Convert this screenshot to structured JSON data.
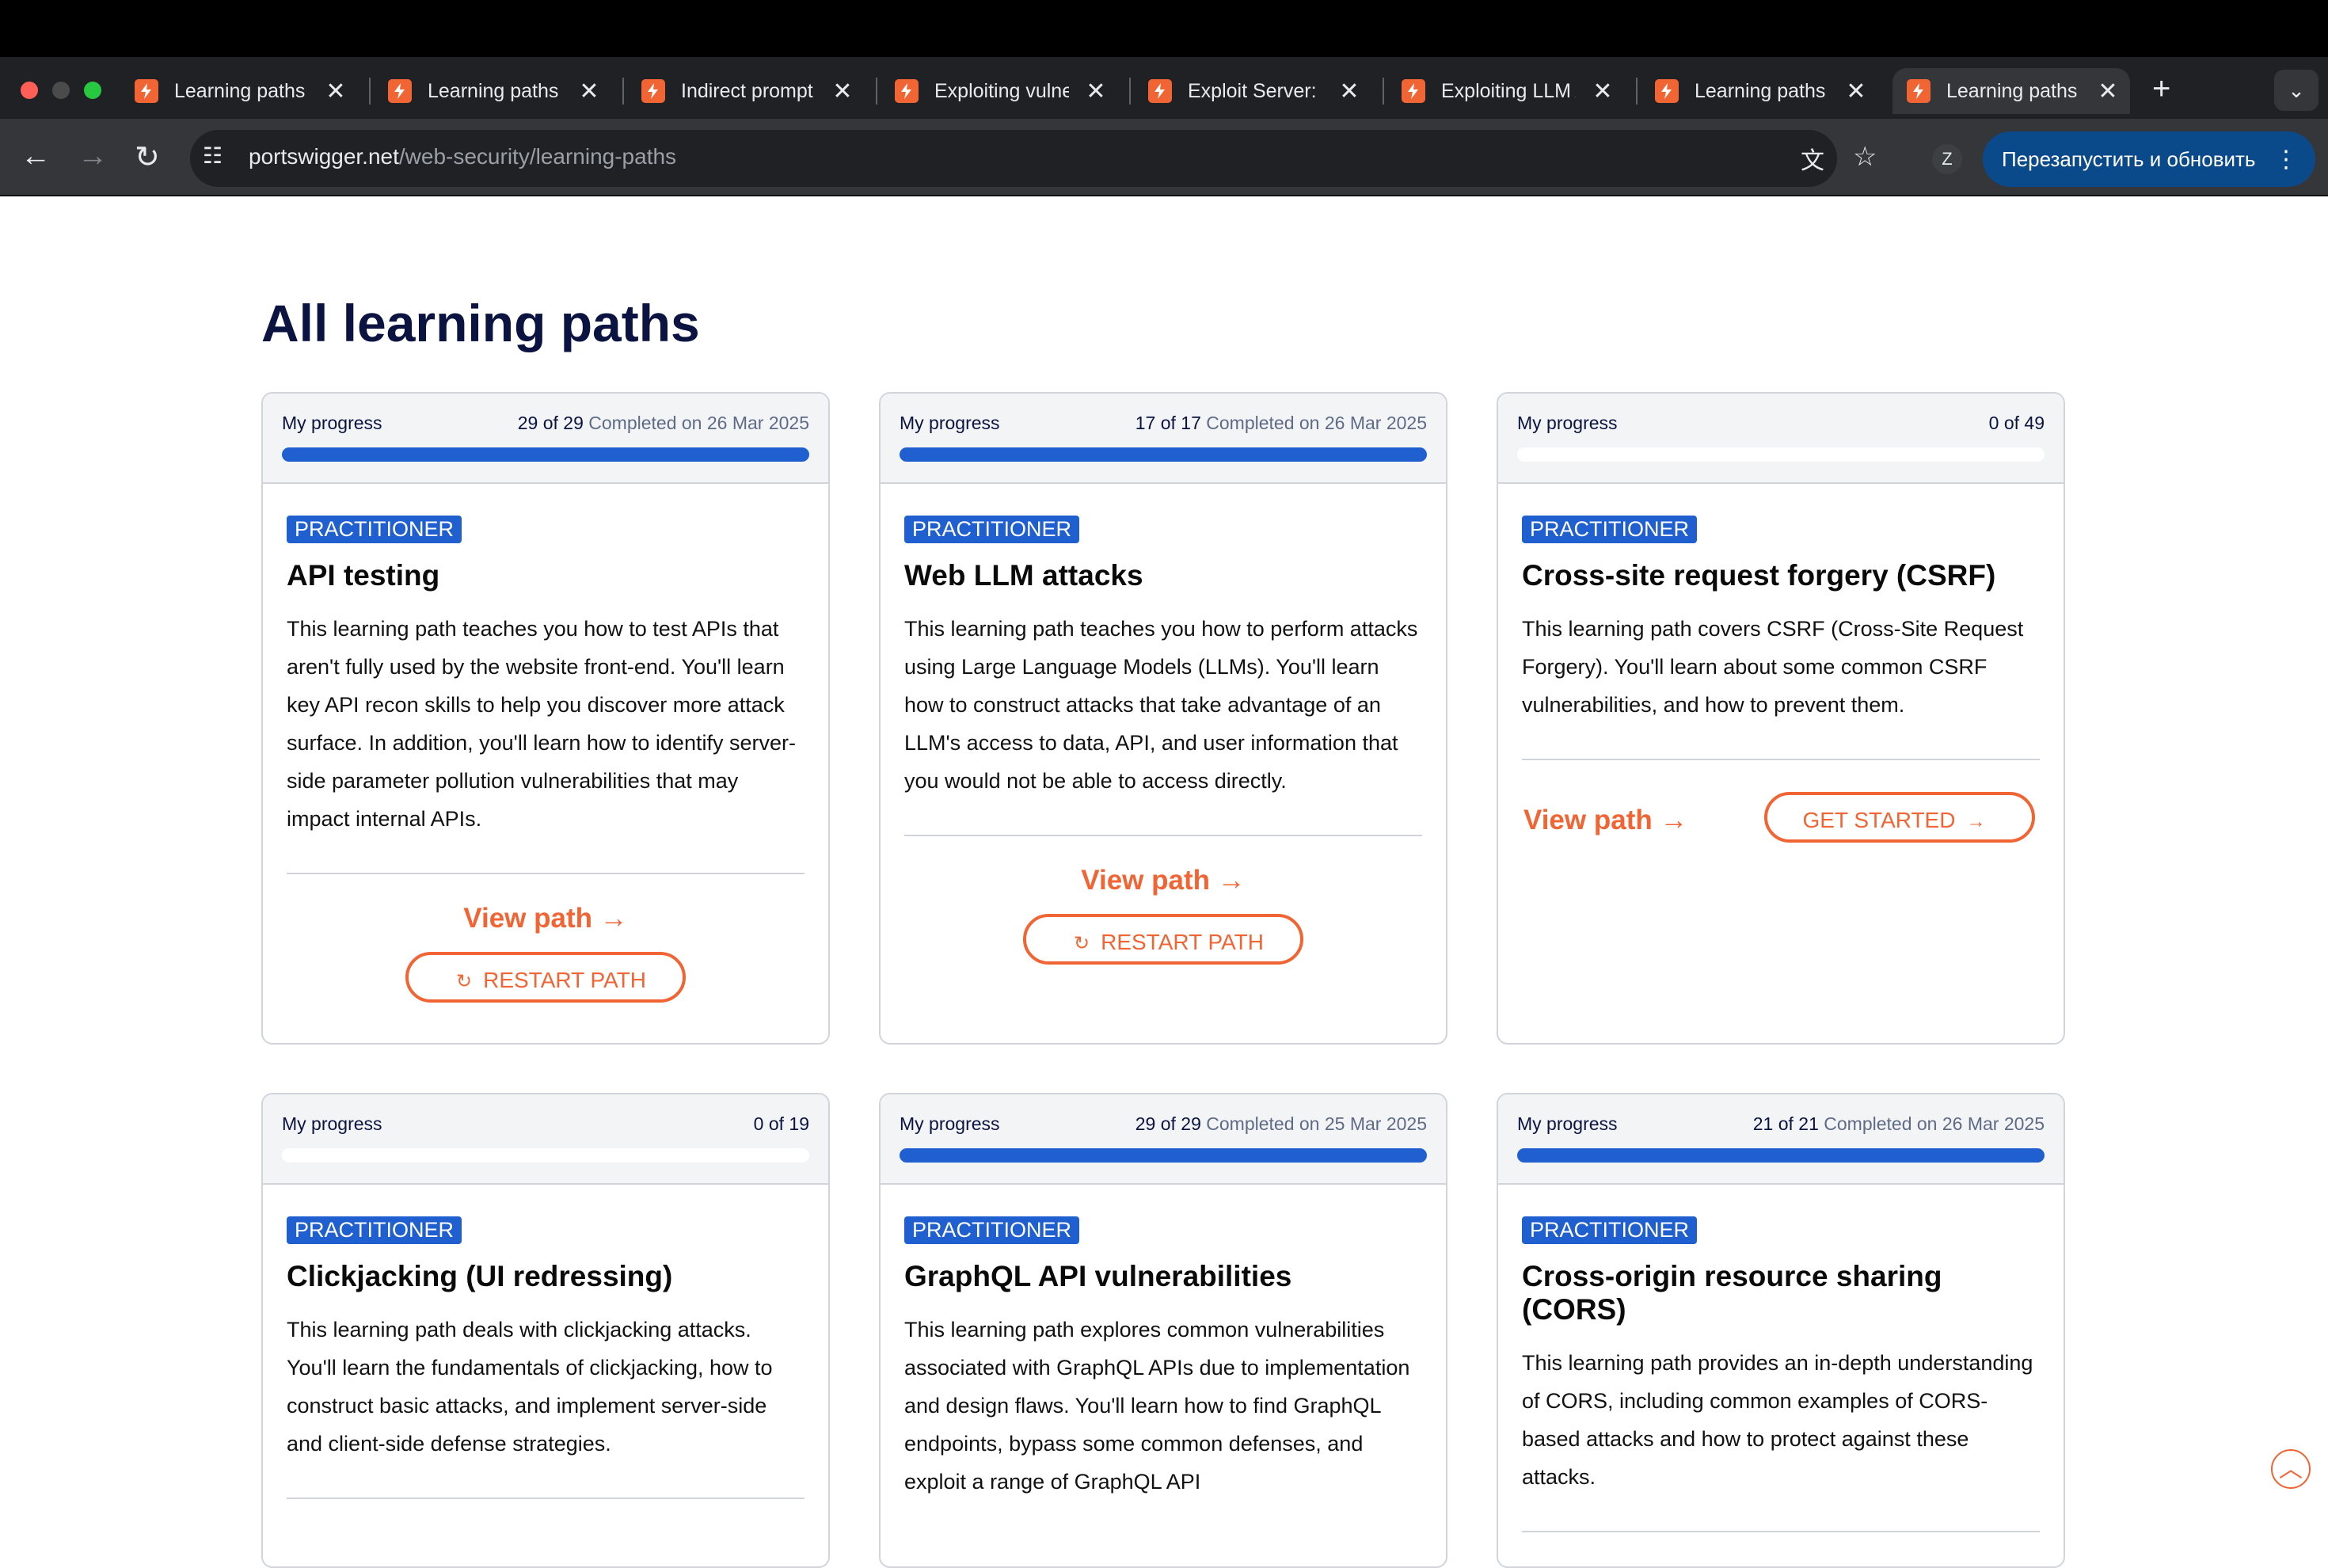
{
  "browser": {
    "tabs": [
      {
        "title": "Learning paths | Web Security Academy"
      },
      {
        "title": "Learning paths | Web Security Academy"
      },
      {
        "title": "Indirect prompt injection"
      },
      {
        "title": "Exploiting vulnerabilities in LLM APIs"
      },
      {
        "title": "Exploit Server: Indirect prompt injection"
      },
      {
        "title": "Exploiting LLM APIs"
      },
      {
        "title": "Learning paths | Web Security Academy"
      },
      {
        "title": "Learning paths | Web Security Academy"
      }
    ],
    "close_glyph": "✕",
    "new_tab": "+",
    "tab_search": "⌄",
    "url_host": "portswigger.net",
    "url_path": "/web-security/learning-paths",
    "avatar": "Z",
    "relaunch_label": "Перезапустить и обновить",
    "menu_glyph": "⋮"
  },
  "page": {
    "title": "All learning paths"
  },
  "labels": {
    "progress": "My progress",
    "view_path": "View path →",
    "restart": "RESTART PATH",
    "get_started": "GET STARTED",
    "restart_icon": "↻",
    "arrow_icon": "→",
    "scroll_top_icon": "︿"
  },
  "cards": [
    {
      "progress": "29 of 29",
      "completed": "Completed on 26 Mar 2025",
      "progress_fraction": 1.0,
      "badge": "PRACTITIONER",
      "title": "API testing",
      "description": "This learning path teaches you how to test APIs that aren't fully used by the website front-end. You'll learn key API recon skills to help you discover more attack surface. In addition, you'll learn how to identify server-side parameter pollution vulnerabilities that may impact internal APIs."
    },
    {
      "progress": "17 of 17",
      "completed": "Completed on 26 Mar 2025",
      "progress_fraction": 1.0,
      "badge": "PRACTITIONER",
      "title": "Web LLM attacks",
      "description": "This learning path teaches you how to perform attacks using Large Language Models (LLMs). You'll learn how to construct attacks that take advantage of an LLM's access to data, API, and user information that you would not be able to access directly."
    },
    {
      "progress": "0 of 49",
      "completed": "",
      "progress_fraction": 0,
      "badge": "PRACTITIONER",
      "title": "Cross-site request forgery (CSRF)",
      "description": "This learning path covers CSRF (Cross-Site Request Forgery). You'll learn about some common CSRF vulnerabilities, and how to prevent them."
    },
    {
      "progress": "0 of 19",
      "completed": "",
      "progress_fraction": 0,
      "badge": "PRACTITIONER",
      "title": "Clickjacking (UI redressing)",
      "description": "This learning path deals with clickjacking attacks. You'll learn the fundamentals of clickjacking, how to construct basic attacks, and implement server-side and client-side defense strategies."
    },
    {
      "progress": "29 of 29",
      "completed": "Completed on 25 Mar 2025",
      "progress_fraction": 1.0,
      "badge": "PRACTITIONER",
      "title": "GraphQL API vulnerabilities",
      "description": "This learning path explores common vulnerabilities associated with GraphQL APIs due to implementation and design flaws. You'll learn how to find GraphQL endpoints, bypass some common defenses, and exploit a range of GraphQL API"
    },
    {
      "progress": "21 of 21",
      "completed": "Completed on 26 Mar 2025",
      "progress_fraction": 1.0,
      "badge": "PRACTITIONER",
      "title": "Cross-origin resource sharing (CORS)",
      "description": "This learning path provides an in-depth understanding of CORS, including common examples of CORS-based attacks and how to protect against these attacks."
    }
  ],
  "colors": {
    "accent": "#f16434",
    "progress_blue": "#1f5fd0",
    "heading_navy": "#0b1340"
  }
}
